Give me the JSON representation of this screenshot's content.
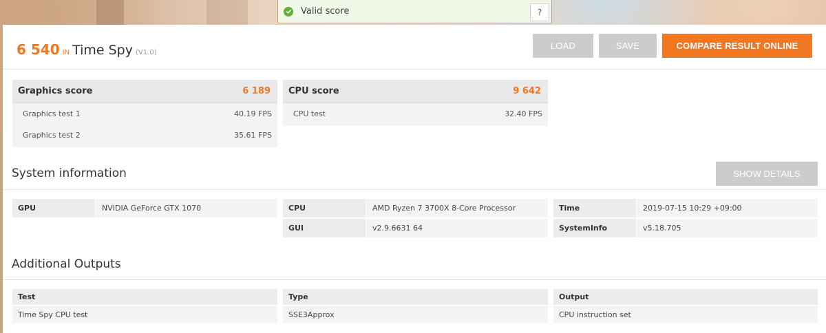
{
  "valid": {
    "label": "Valid score",
    "help_label": "?"
  },
  "header": {
    "score": "6 540",
    "in_label": "IN",
    "benchmark_name": "Time Spy",
    "version": "(V1.0)",
    "load_label": "LOAD",
    "save_label": "SAVE",
    "compare_label": "COMPARE RESULT ONLINE"
  },
  "graphics": {
    "label": "Graphics score",
    "value": "6 189",
    "tests": [
      {
        "name": "Graphics test 1",
        "value": "40.19 FPS"
      },
      {
        "name": "Graphics test 2",
        "value": "35.61 FPS"
      }
    ]
  },
  "cpu": {
    "label": "CPU score",
    "value": "9 642",
    "tests": [
      {
        "name": "CPU test",
        "value": "32.40 FPS"
      }
    ]
  },
  "system_info": {
    "title": "System information",
    "show_details_label": "SHOW DETAILS",
    "gpu_key": "GPU",
    "gpu_value": "NVIDIA GeForce GTX 1070",
    "cpu_key": "CPU",
    "cpu_value": "AMD Ryzen 7 3700X 8-Core Processor",
    "time_key": "Time",
    "time_value": "2019-07-15 10:29 +09:00",
    "gui_key": "GUI",
    "gui_value": "v2.9.6631 64",
    "sysinfo_key": "SystemInfo",
    "sysinfo_value": "v5.18.705"
  },
  "additional_outputs": {
    "title": "Additional Outputs",
    "columns": [
      "Test",
      "Type",
      "Output"
    ],
    "rows": [
      [
        "Time Spy CPU test",
        "SSE3Approx",
        "CPU instruction set"
      ]
    ]
  },
  "colors": {
    "accent": "#f27722",
    "valid_green": "#62b03a",
    "button_disabled": "#cccccc"
  }
}
